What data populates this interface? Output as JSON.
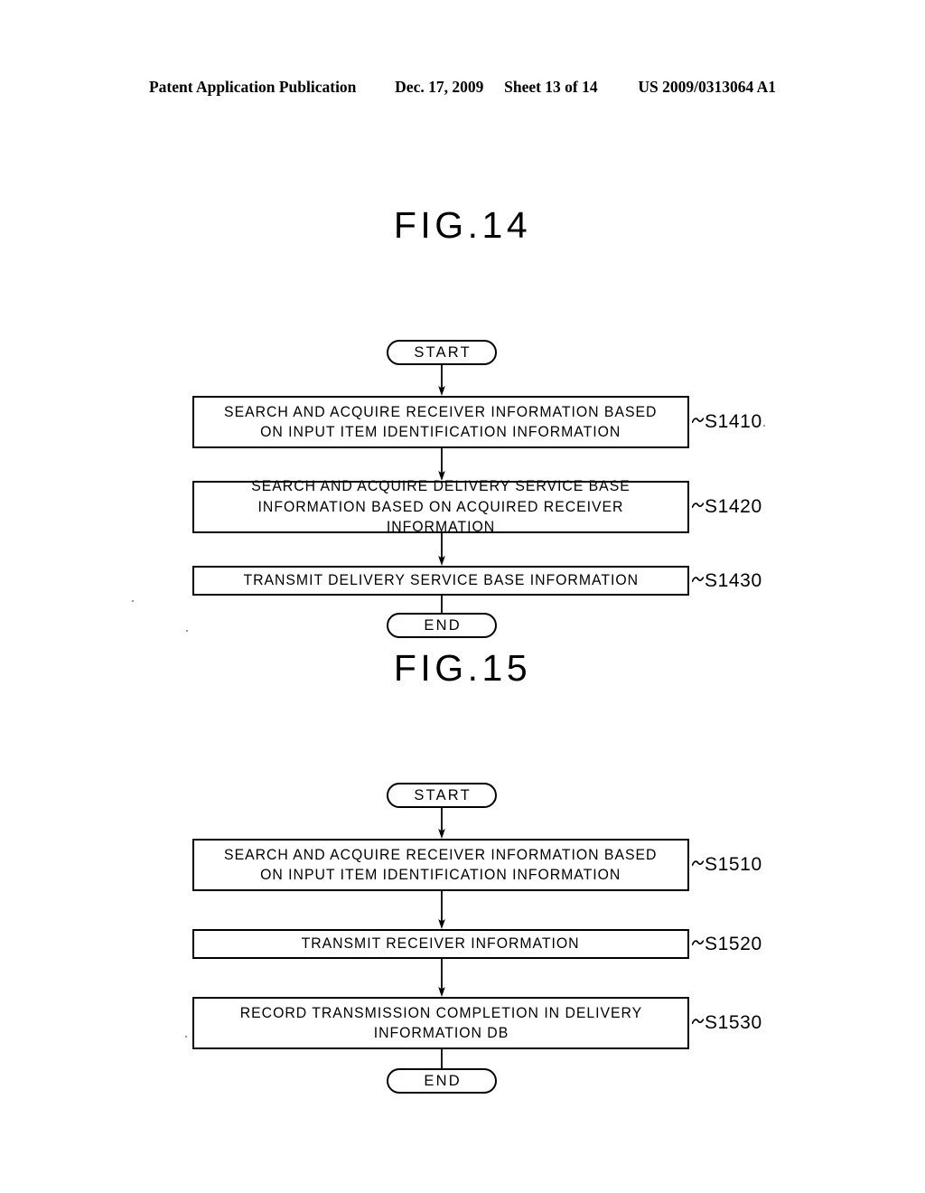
{
  "header": {
    "publication": "Patent Application Publication",
    "date": "Dec. 17, 2009",
    "sheet": "Sheet 13 of 14",
    "doc_number": "US 2009/0313064 A1"
  },
  "figures": [
    {
      "title": "FIG.14",
      "start_label": "START",
      "end_label": "END",
      "steps": [
        {
          "text": "SEARCH AND ACQUIRE RECEIVER INFORMATION BASED\nON INPUT ITEM IDENTIFICATION INFORMATION",
          "ref": "S1410"
        },
        {
          "text": "SEARCH AND ACQUIRE DELIVERY SERVICE BASE\nINFORMATION BASED ON ACQUIRED RECEIVER INFORMATION",
          "ref": "S1420"
        },
        {
          "text": "TRANSMIT DELIVERY SERVICE BASE INFORMATION",
          "ref": "S1430"
        }
      ]
    },
    {
      "title": "FIG.15",
      "start_label": "START",
      "end_label": "END",
      "steps": [
        {
          "text": "SEARCH AND ACQUIRE RECEIVER INFORMATION BASED\nON INPUT ITEM IDENTIFICATION INFORMATION",
          "ref": "S1510"
        },
        {
          "text": "TRANSMIT RECEIVER INFORMATION",
          "ref": "S1520"
        },
        {
          "text": "RECORD TRANSMISSION COMPLETION IN DELIVERY\nINFORMATION DB",
          "ref": "S1530"
        }
      ]
    }
  ],
  "colors": {
    "ink": "#000000",
    "paper": "#ffffff"
  }
}
